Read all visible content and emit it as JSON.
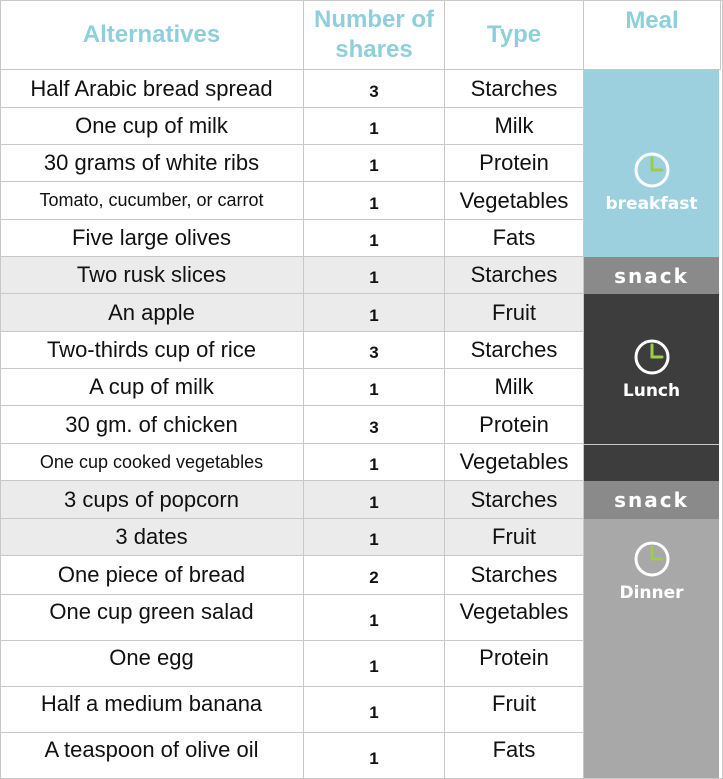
{
  "header": {
    "alternatives": "Alternatives",
    "shares": "Number of shares",
    "type": "Type",
    "meal": "Meal"
  },
  "rows": [
    {
      "alt": "Half Arabic bread spread",
      "shares": "3",
      "type": "Starches"
    },
    {
      "alt": "One cup of milk",
      "shares": "1",
      "type": "Milk"
    },
    {
      "alt": "30 grams of white ribs",
      "shares": "1",
      "type": "Protein"
    },
    {
      "alt": "Tomato, cucumber, or carrot",
      "shares": "1",
      "type": "Vegetables"
    },
    {
      "alt": "Five large olives",
      "shares": "1",
      "type": "Fats"
    },
    {
      "alt": "Two rusk slices",
      "shares": "1",
      "type": "Starches"
    },
    {
      "alt": "An apple",
      "shares": "1",
      "type": "Fruit"
    },
    {
      "alt": "Two-thirds cup of rice",
      "shares": "3",
      "type": "Starches"
    },
    {
      "alt": "A cup of milk",
      "shares": "1",
      "type": "Milk"
    },
    {
      "alt": "30 gm. of chicken",
      "shares": "3",
      "type": "Protein"
    },
    {
      "alt": "One cup cooked vegetables",
      "shares": "1",
      "type": "Vegetables"
    },
    {
      "alt": "3 cups of popcorn",
      "shares": "1",
      "type": "Starches"
    },
    {
      "alt": "3 dates",
      "shares": "1",
      "type": "Fruit"
    },
    {
      "alt": "One piece of bread",
      "shares": "2",
      "type": "Starches"
    },
    {
      "alt": "One cup green salad",
      "shares": "1",
      "type": "Vegetables"
    },
    {
      "alt": "One egg",
      "shares": "1",
      "type": "Protein"
    },
    {
      "alt": "Half a medium banana",
      "shares": "1",
      "type": "Fruit"
    },
    {
      "alt": "A teaspoon of olive oil",
      "shares": "1",
      "type": "Fats"
    }
  ],
  "meals": [
    {
      "label": "breakfast",
      "icon": "clock-icon",
      "color": "#9dd0de"
    },
    {
      "label": "snack",
      "icon": "",
      "color": "#8a8a8a"
    },
    {
      "label": "Lunch",
      "icon": "clock-icon",
      "color": "#3d3d3d"
    },
    {
      "label": "snack",
      "icon": "",
      "color": "#8a8a8a"
    },
    {
      "label": "Dinner",
      "icon": "clock-icon",
      "color": "#a8a8a8"
    }
  ],
  "colors": {
    "header_text": "#8fcfdc",
    "row_highlight": "#ebebeb",
    "clock_hand": "#9ccc4a"
  }
}
